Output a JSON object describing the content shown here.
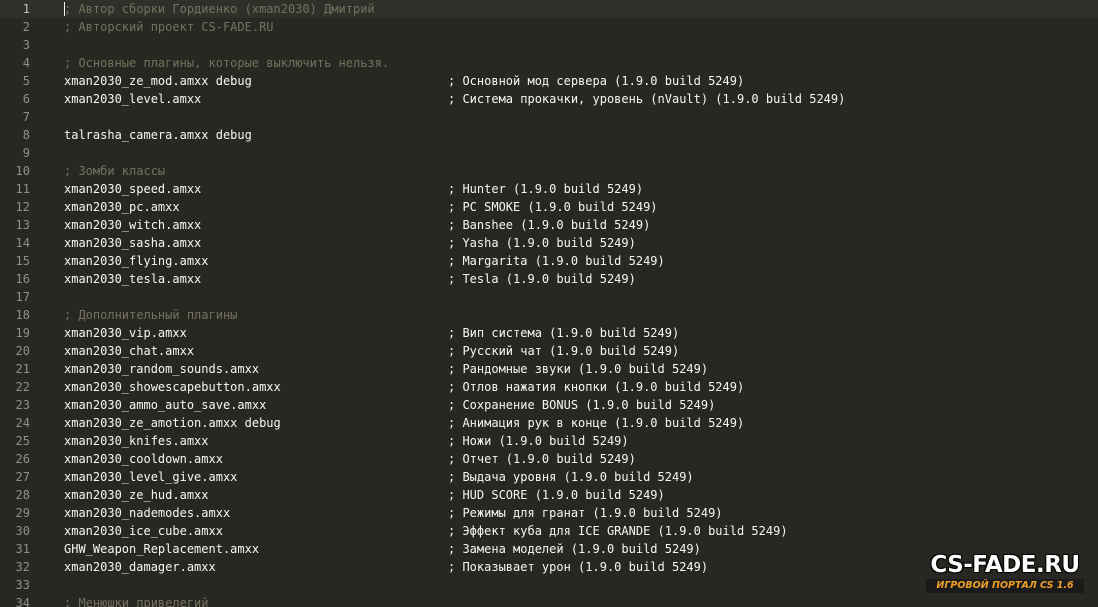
{
  "editor": {
    "current_line": 1,
    "lines": [
      {
        "num": "1",
        "code": "; Автор сборки Гордиенко (xman2030) Дмитрий",
        "comment": "",
        "is_comment": true
      },
      {
        "num": "2",
        "code": "; Авторский проект CS-FADE.RU",
        "comment": "",
        "is_comment": true
      },
      {
        "num": "3",
        "code": "",
        "comment": "",
        "is_comment": false
      },
      {
        "num": "4",
        "code": "; Основные плагины, которые выключить нельзя.",
        "comment": "",
        "is_comment": true
      },
      {
        "num": "5",
        "code": "xman2030_ze_mod.amxx debug",
        "comment": "; Основной мод сервера (1.9.0 build 5249)",
        "is_comment": false
      },
      {
        "num": "6",
        "code": "xman2030_level.amxx",
        "comment": "; Система прокачки, уровень (nVault) (1.9.0 build 5249)",
        "is_comment": false
      },
      {
        "num": "7",
        "code": "",
        "comment": "",
        "is_comment": false
      },
      {
        "num": "8",
        "code": "talrasha_camera.amxx debug",
        "comment": "",
        "is_comment": false
      },
      {
        "num": "9",
        "code": "",
        "comment": "",
        "is_comment": false
      },
      {
        "num": "10",
        "code": "; Зомби классы",
        "comment": "",
        "is_comment": true
      },
      {
        "num": "11",
        "code": "xman2030_speed.amxx",
        "comment": "; Hunter (1.9.0 build 5249)",
        "is_comment": false
      },
      {
        "num": "12",
        "code": "xman2030_pc.amxx",
        "comment": "; PC SMOKE (1.9.0 build 5249)",
        "is_comment": false
      },
      {
        "num": "13",
        "code": "xman2030_witch.amxx",
        "comment": "; Banshee (1.9.0 build 5249)",
        "is_comment": false
      },
      {
        "num": "14",
        "code": "xman2030_sasha.amxx",
        "comment": "; Yasha (1.9.0 build 5249)",
        "is_comment": false
      },
      {
        "num": "15",
        "code": "xman2030_flying.amxx",
        "comment": "; Margarita (1.9.0 build 5249)",
        "is_comment": false
      },
      {
        "num": "16",
        "code": "xman2030_tesla.amxx",
        "comment": "; Tesla (1.9.0 build 5249)",
        "is_comment": false
      },
      {
        "num": "17",
        "code": "",
        "comment": "",
        "is_comment": false
      },
      {
        "num": "18",
        "code": "; Дополнительный плагины",
        "comment": "",
        "is_comment": true
      },
      {
        "num": "19",
        "code": "xman2030_vip.amxx",
        "comment": "; Вип система (1.9.0 build 5249)",
        "is_comment": false
      },
      {
        "num": "20",
        "code": "xman2030_chat.amxx",
        "comment": "; Русский чат (1.9.0 build 5249)",
        "is_comment": false
      },
      {
        "num": "21",
        "code": "xman2030_random_sounds.amxx",
        "comment": "; Рандомные звуки (1.9.0 build 5249)",
        "is_comment": false
      },
      {
        "num": "22",
        "code": "xman2030_showescapebutton.amxx",
        "comment": "; Отлов нажатия кнопки (1.9.0 build 5249)",
        "is_comment": false
      },
      {
        "num": "23",
        "code": "xman2030_ammo_auto_save.amxx",
        "comment": "; Сохранение BONUS (1.9.0 build 5249)",
        "is_comment": false
      },
      {
        "num": "24",
        "code": "xman2030_ze_amotion.amxx debug",
        "comment": "; Анимация рук в конце (1.9.0 build 5249)",
        "is_comment": false
      },
      {
        "num": "25",
        "code": "xman2030_knifes.amxx",
        "comment": "; Ножи (1.9.0 build 5249)",
        "is_comment": false
      },
      {
        "num": "26",
        "code": "xman2030_cooldown.amxx",
        "comment": "; Отчет (1.9.0 build 5249)",
        "is_comment": false
      },
      {
        "num": "27",
        "code": "xman2030_level_give.amxx",
        "comment": "; Выдача уровня (1.9.0 build 5249)",
        "is_comment": false
      },
      {
        "num": "28",
        "code": "xman2030_ze_hud.amxx",
        "comment": "; HUD SCORE (1.9.0 build 5249)",
        "is_comment": false
      },
      {
        "num": "29",
        "code": "xman2030_nademodes.amxx",
        "comment": "; Режимы для гранат (1.9.0 build 5249)",
        "is_comment": false
      },
      {
        "num": "30",
        "code": "xman2030_ice_cube.amxx",
        "comment": "; Эффект куба для ICE GRANDE (1.9.0 build 5249)",
        "is_comment": false
      },
      {
        "num": "31",
        "code": "GHW_Weapon_Replacement.amxx",
        "comment": "; Замена моделей (1.9.0 build 5249)",
        "is_comment": false
      },
      {
        "num": "32",
        "code": "xman2030_damager.amxx",
        "comment": "; Показывает урон (1.9.0 build 5249)",
        "is_comment": false
      },
      {
        "num": "33",
        "code": "",
        "comment": "",
        "is_comment": false
      },
      {
        "num": "34",
        "code": "; Менюшки привелегий",
        "comment": "",
        "is_comment": true
      }
    ]
  },
  "watermark": {
    "title": "CS-FADE.RU",
    "subtitle": "ИГРОВОЙ ПОРТАЛ CS 1.6"
  },
  "colors": {
    "background": "#272822",
    "text": "#f8f8f2",
    "comment": "#75715e",
    "line_number": "#8f908a",
    "logo_accent": "#f0a020"
  }
}
